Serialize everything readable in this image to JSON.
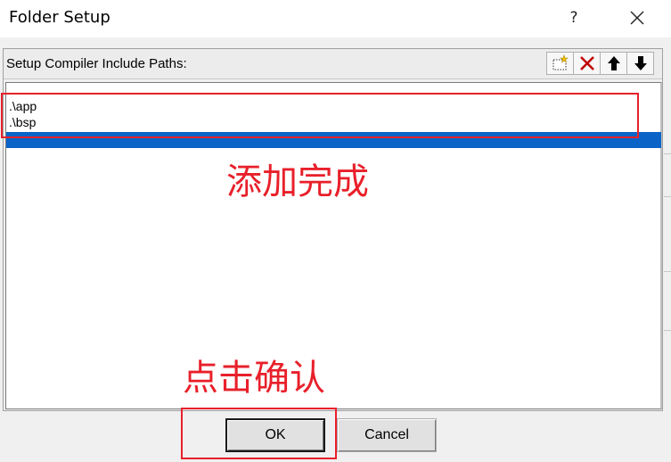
{
  "window": {
    "title": "Folder Setup",
    "help_label": "?",
    "close_icon": "close-icon"
  },
  "panel": {
    "label": "Setup Compiler Include Paths:",
    "toolbar_icons": [
      "new-folder-icon",
      "delete-icon",
      "move-up-icon",
      "move-down-icon"
    ]
  },
  "paths": [
    ".\\app",
    ".\\bsp"
  ],
  "buttons": {
    "ok": "OK",
    "cancel": "Cancel"
  },
  "annotations": {
    "added": "添加完成",
    "confirm": "点击确认",
    "color": "#e8202a"
  },
  "colors": {
    "selection": "#0a64c8"
  }
}
